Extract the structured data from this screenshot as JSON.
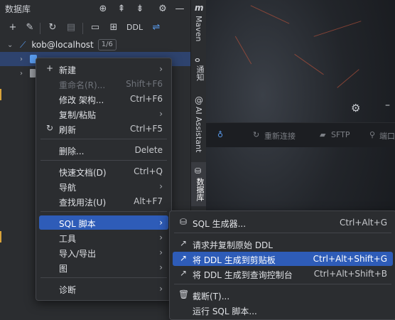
{
  "db_panel": {
    "title": "数据库",
    "header_icons": [
      "add-circle-icon",
      "expand-all-icon",
      "collapse-all-icon",
      "gear-icon",
      "minimize-icon"
    ],
    "toolbar": {
      "ddl_label": "DDL",
      "icons": [
        "add-icon",
        "datasource-properties-icon",
        "refresh-icon",
        "stop-icon",
        "sql-console-icon",
        "table-view-icon",
        "jump-icon"
      ]
    },
    "tree": {
      "root_label": "kob@localhost",
      "root_badge": "1/6"
    }
  },
  "right_strip": {
    "items": [
      "Maven",
      "通知",
      "AI Assistant",
      "数据库"
    ]
  },
  "editor_bg": {
    "toolbar_items": [
      "重新连接",
      "SFTP",
      "端口"
    ]
  },
  "main_menu": {
    "items": [
      {
        "label": "新建",
        "shortcut": "",
        "submenu": true,
        "icon": "plus-icon"
      },
      {
        "label": "重命名(R)...",
        "shortcut": "Shift+F6",
        "disabled": true
      },
      {
        "label": "修改 架构...",
        "shortcut": "Ctrl+F6"
      },
      {
        "label": "复制/粘贴",
        "shortcut": "",
        "submenu": true
      },
      {
        "label": "刷新",
        "shortcut": "Ctrl+F5",
        "icon": "refresh-icon"
      },
      {
        "label": "删除...",
        "shortcut": "Delete"
      },
      {
        "label": "快速文档(D)",
        "shortcut": "Ctrl+Q"
      },
      {
        "label": "导航",
        "shortcut": "",
        "submenu": true
      },
      {
        "label": "查找用法(U)",
        "shortcut": "Alt+F7"
      },
      {
        "label": "SQL 脚本",
        "shortcut": "",
        "submenu": true,
        "selected": true
      },
      {
        "label": "工具",
        "shortcut": "",
        "submenu": true
      },
      {
        "label": "导入/导出",
        "shortcut": "",
        "submenu": true
      },
      {
        "label": "图",
        "shortcut": "",
        "submenu": true
      },
      {
        "label": "诊断",
        "shortcut": "",
        "submenu": true
      }
    ]
  },
  "sub_menu": {
    "items": [
      {
        "label": "SQL 生成器...",
        "shortcut": "Ctrl+Alt+G",
        "icon": "sql-generator-icon"
      },
      {
        "label": "请求并复制原始 DDL",
        "shortcut": "",
        "icon": "copy-ddl-icon"
      },
      {
        "label": "将 DDL 生成到剪贴板",
        "shortcut": "Ctrl+Alt+Shift+G",
        "icon": "ddl-clipboard-icon",
        "selected": true
      },
      {
        "label": "将 DDL 生成到查询控制台",
        "shortcut": "Ctrl+Alt+Shift+B",
        "icon": "ddl-console-icon"
      },
      {
        "label": "截断(T)...",
        "shortcut": "",
        "icon": "trash-icon"
      },
      {
        "label": "运行 SQL 脚本...",
        "shortcut": ""
      }
    ]
  }
}
